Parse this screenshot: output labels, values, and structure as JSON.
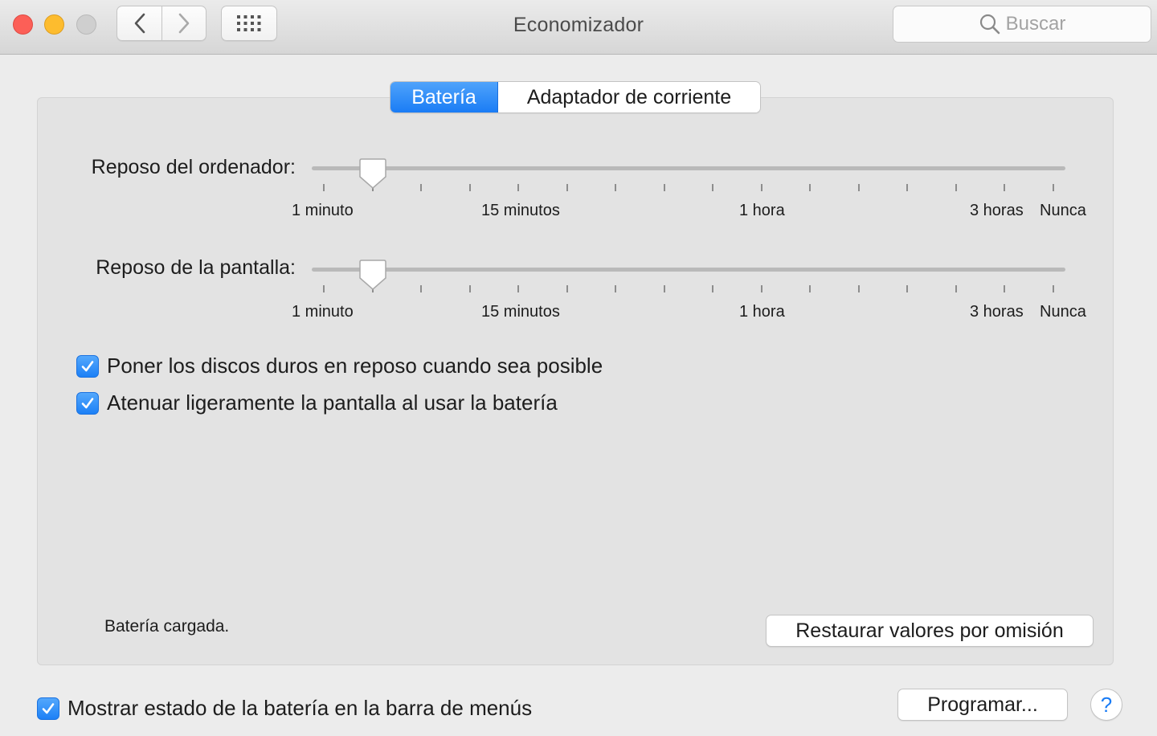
{
  "window": {
    "title": "Economizador",
    "search_placeholder": "Buscar"
  },
  "toolbar": {
    "back_icon": "chevron-left-icon",
    "forward_icon": "chevron-right-icon",
    "show_all_icon": "grid-icon"
  },
  "tabs": [
    {
      "label": "Batería",
      "active": true
    },
    {
      "label": "Adaptador de corriente",
      "active": false
    }
  ],
  "sliders": [
    {
      "label": "Reposo del ordenador:",
      "tick_labels": [
        "1 minuto",
        "15 minutos",
        "1 hora",
        "3 horas",
        "Nunca"
      ],
      "tick_count": 16,
      "value_index": 1
    },
    {
      "label": "Reposo de la pantalla:",
      "tick_labels": [
        "1 minuto",
        "15 minutos",
        "1 hora",
        "3 horas",
        "Nunca"
      ],
      "tick_count": 16,
      "value_index": 1
    }
  ],
  "options": [
    {
      "label": "Poner los discos duros en reposo cuando sea posible",
      "checked": true
    },
    {
      "label": "Atenuar ligeramente la pantalla al usar la batería",
      "checked": true
    }
  ],
  "status": "Batería cargada.",
  "buttons": {
    "restore": "Restaurar valores por omisión",
    "schedule": "Programar...",
    "help": "?"
  },
  "footer": {
    "menu_bar_option": {
      "label": "Mostrar estado de la batería en la barra de menús",
      "checked": true
    }
  },
  "colors": {
    "accent": "#1a7cf5",
    "close": "#fc5f57",
    "minimize": "#fdbc2e",
    "zoom_disabled": "#cfcfcf"
  }
}
